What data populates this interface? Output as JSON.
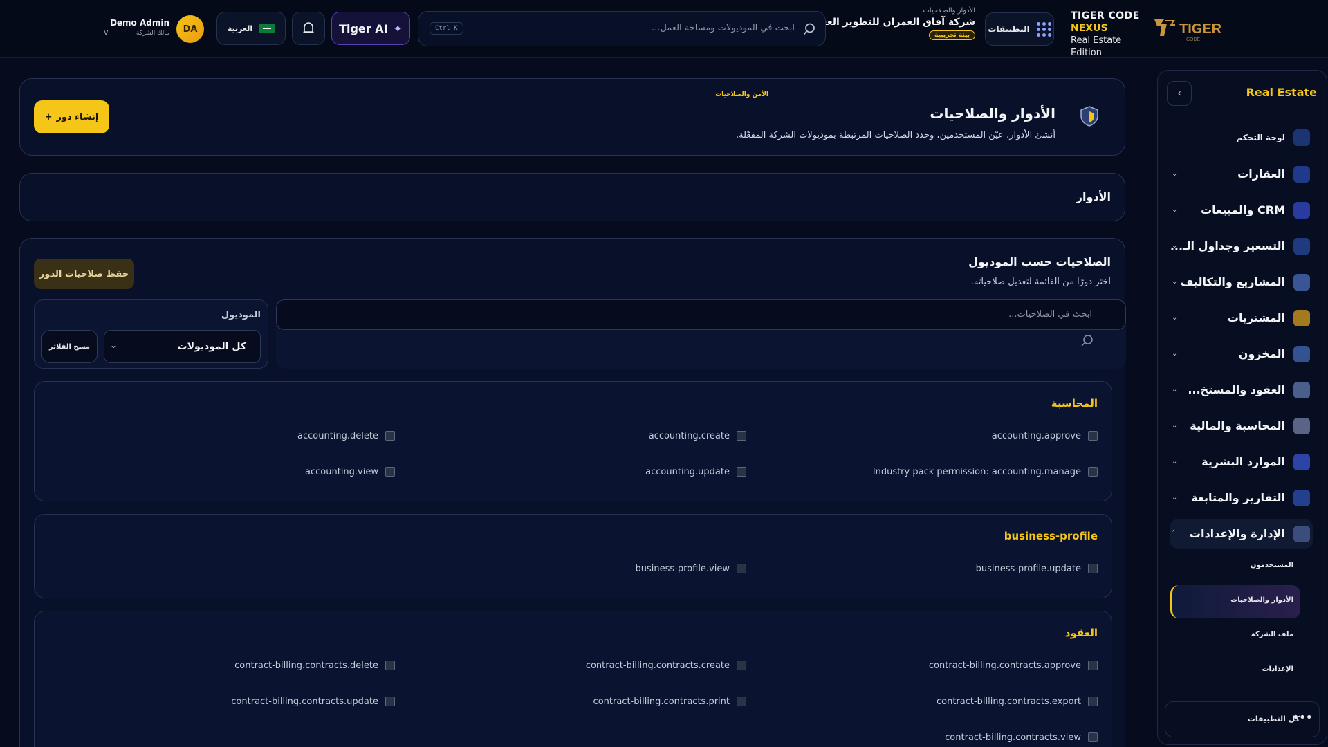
{
  "header": {
    "brand_line1": "TIGER CODE",
    "brand_line2": "NEXUS",
    "brand_line3": "Real Estate Edition",
    "apps_label": "التطبيقات",
    "breadcrumb": "الأدوار والصلاحيات",
    "company_name": "شركة آفاق العمران للتطوير العقاري",
    "env_badge": "بيئة تجريبية",
    "search_placeholder": "ابحث في الموديولات ومساحة العمل...",
    "search_shortcut": "Ctrl K",
    "ai_label": "Tiger AI",
    "language_label": "العربية",
    "user_initials": "DA",
    "user_name": "Demo Admin",
    "user_role": "مالك الشركة"
  },
  "sidebar": {
    "title": "Real Estate",
    "items": [
      {
        "label": "لوحة التحكم",
        "icon": "dashboard-icon",
        "color": "#3d6bd8"
      },
      {
        "label": "العقارات",
        "icon": "building-icon",
        "color": "#4f7cf0"
      },
      {
        "label": "CRM والمبيعات",
        "icon": "users-icon",
        "color": "#5b6ff0"
      },
      {
        "label": "التسعير وجداول الـ...",
        "icon": "pricing-icon",
        "color": "#3f67c9"
      },
      {
        "label": "المشاريع والتكاليف",
        "icon": "projects-icon",
        "color": "#6a8ad8"
      },
      {
        "label": "المشتريات",
        "icon": "cart-icon",
        "color": "#e0a92a"
      },
      {
        "label": "المخزون",
        "icon": "warehouse-icon",
        "color": "#5e86d6"
      },
      {
        "label": "العقود والمستخ...",
        "icon": "contracts-icon",
        "color": "#7b93c9"
      },
      {
        "label": "المحاسبة والمالية",
        "icon": "finance-icon",
        "color": "#8f9bbf"
      },
      {
        "label": "الموارد البشرية",
        "icon": "hr-icon",
        "color": "#5a74e0"
      },
      {
        "label": "التقارير والمتابعة",
        "icon": "reports-icon",
        "color": "#4b6fd0"
      },
      {
        "label": "الإدارة والإعدادات",
        "icon": "settings-icon",
        "color": "#9fb0d8"
      }
    ],
    "sub_items": [
      {
        "label": "المستخدمون"
      },
      {
        "label": "الأدوار والصلاحيات"
      },
      {
        "label": "ملف الشركة"
      },
      {
        "label": "الإعدادات"
      }
    ],
    "all_apps": "كل التطبيقات"
  },
  "page": {
    "breadcrumb": "الأمن والصلاحيات",
    "title": "الأدوار والصلاحيات",
    "description": "أنشئ الأدوار، عيّن المستخدمين، وحدد الصلاحيات المرتبطة بموديولات الشركة المفعّلة.",
    "create_button": "إنشاء دور",
    "roles_title": "الأدوار",
    "permissions_title": "الصلاحيات حسب الموديول",
    "permissions_subtitle": "اختر دورًا من القائمة لتعديل صلاحياته.",
    "save_button": "حفظ صلاحيات الدور",
    "module_label": "الموديول",
    "module_value": "كل الموديولات",
    "clear_filter": "مسح الفلاتر",
    "search_placeholder": "ابحث في الصلاحيات..."
  },
  "modules": [
    {
      "title": "المحاسبة",
      "permissions": [
        "accounting.approve",
        "accounting.create",
        "accounting.delete",
        "Industry pack permission: accounting.manage",
        "accounting.update",
        "accounting.view"
      ]
    },
    {
      "title": "business-profile",
      "permissions": [
        "business-profile.update",
        "business-profile.view"
      ]
    },
    {
      "title": "العقود",
      "permissions": [
        "contract-billing.contracts.approve",
        "contract-billing.contracts.create",
        "contract-billing.contracts.delete",
        "contract-billing.contracts.export",
        "contract-billing.contracts.print",
        "contract-billing.contracts.update",
        "contract-billing.contracts.view"
      ]
    }
  ],
  "colors": {
    "accent": "#f5c518",
    "background": "#060c1d",
    "card": "#08102a",
    "border": "#26324f"
  }
}
